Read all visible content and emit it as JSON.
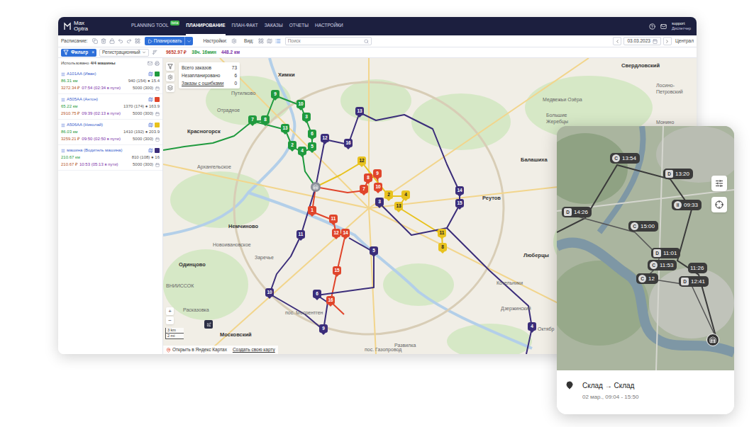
{
  "header": {
    "logo_top": "Max",
    "logo_bottom": "Optra",
    "nav": [
      {
        "label": "PLANNING TOOL",
        "badge": "beta",
        "selected": false
      },
      {
        "label": "ПЛАНИРОВАНИЕ",
        "badge": "",
        "selected": true
      },
      {
        "label": "ПЛАН-ФАКТ",
        "badge": "",
        "selected": false
      },
      {
        "label": "ЗАКАЗЫ",
        "badge": "",
        "selected": false
      },
      {
        "label": "ОТЧЕТЫ",
        "badge": "",
        "selected": false
      },
      {
        "label": "НАСТРОЙКИ",
        "badge": "",
        "selected": false
      }
    ],
    "user": "support",
    "role": "Диспетчер"
  },
  "toolbar": {
    "schedule_label": "Расписание:",
    "plan_button": "Планировать",
    "settings_label": "Настройки:",
    "view_label": "Вид:",
    "search_placeholder": "Поиск",
    "date": "03.03.2023",
    "region": "Централ"
  },
  "filter_bar": {
    "filter": "Фильтр",
    "clear": "×",
    "sort": "Регистрационный",
    "cost": "9652.97 ₽",
    "time": "38ч. 16мин",
    "distance": "448.2 км"
  },
  "vehicles_panel": {
    "used_label": "Использовано",
    "used_value": "4/4 машины",
    "vehicles": [
      {
        "name": "A101AA (Иван)",
        "color": "#1f9a3e",
        "distance": "86.31 км",
        "load": "940 (154) ● 15.4",
        "cost": "3272.34 ₽",
        "time": "07:54 (02:34 в пути)",
        "capacity": "5000 (300)"
      },
      {
        "name": "A505AA (Антон)",
        "color": "#e0452b",
        "distance": "65.22 км",
        "load": "1370 (174) ● 163.9",
        "cost": "2910.75 ₽",
        "time": "09:39 (02:13 в пути)",
        "capacity": "5000 (300)"
      },
      {
        "name": "A506AA (Николай)",
        "color": "#e8c21e",
        "distance": "86.03 км",
        "load": "1410 (192) ● 203.9",
        "cost": "3259.21 ₽",
        "time": "09:50 (02:50 в пути)",
        "capacity": "5000 (300)"
      },
      {
        "name": "машина (Водитель машина)",
        "color": "#3b2d7a",
        "distance": "210.67 км",
        "load": "810 (108) ● 16",
        "cost": "210.67 ₽",
        "time": "10:53 (05:13 в пути)",
        "capacity": "5000 (300)"
      }
    ]
  },
  "map": {
    "summary": [
      {
        "label": "Всего заказов",
        "value": "73",
        "underlined": false
      },
      {
        "label": "Незапланировано",
        "value": "6",
        "underlined": false
      },
      {
        "label": "Заказы с ошибками",
        "value": "0",
        "underlined": true
      }
    ],
    "labels": [
      {
        "text": "Химки",
        "bold": true
      },
      {
        "text": "Свердловский",
        "bold": true
      },
      {
        "text": "Лосино-Петровский",
        "bold": false
      },
      {
        "text": "Путилково",
        "bold": false
      },
      {
        "text": "Отрадное",
        "bold": false
      },
      {
        "text": "Красногорск",
        "bold": true
      },
      {
        "text": "Медвежьи Озёра",
        "bold": false
      },
      {
        "text": "Большие Жеребцы",
        "bold": false
      },
      {
        "text": "Монино",
        "bold": false
      },
      {
        "text": "Балашиха",
        "bold": true
      },
      {
        "text": "Реутов",
        "bold": true
      },
      {
        "text": "Архангельское",
        "bold": false
      },
      {
        "text": "Немчиново",
        "bold": true
      },
      {
        "text": "Новоивановское",
        "bold": false
      },
      {
        "text": "Заречье",
        "bold": false
      },
      {
        "text": "Одинцово",
        "bold": true
      },
      {
        "text": "Люберцы",
        "bold": true
      },
      {
        "text": "Котельники",
        "bold": false
      },
      {
        "text": "Дзержинский",
        "bold": false
      },
      {
        "text": "пос. Мосрентген",
        "bold": false
      },
      {
        "text": "Московский",
        "bold": true
      },
      {
        "text": "Развилка",
        "bold": false
      },
      {
        "text": "Расказовка",
        "bold": false
      },
      {
        "text": "ВНИИССОК",
        "bold": false
      },
      {
        "text": "пос. Газопровод",
        "bold": false
      },
      {
        "text": "Октябр",
        "bold": false
      }
    ],
    "pins": [
      {
        "label": "9",
        "color": "#1f9a3e"
      },
      {
        "label": "10",
        "color": "#1f9a3e"
      },
      {
        "label": "3",
        "color": "#1f9a3e"
      },
      {
        "label": "7",
        "color": "#1f9a3e"
      },
      {
        "label": "8",
        "color": "#1f9a3e"
      },
      {
        "label": "13",
        "color": "#1f9a3e"
      },
      {
        "label": "6",
        "color": "#1f9a3e"
      },
      {
        "label": "2",
        "color": "#1f9a3e"
      },
      {
        "label": "4",
        "color": "#1f9a3e"
      },
      {
        "label": "5",
        "color": "#1f9a3e"
      },
      {
        "label": "13",
        "color": "#3b2d7a"
      },
      {
        "label": "16",
        "color": "#3b2d7a"
      },
      {
        "label": "12",
        "color": "#3b2d7a"
      },
      {
        "label": "14",
        "color": "#3b2d7a"
      },
      {
        "label": "15",
        "color": "#3b2d7a"
      },
      {
        "label": "11",
        "color": "#3b2d7a"
      },
      {
        "label": "3",
        "color": "#3b2d7a"
      },
      {
        "label": "5",
        "color": "#3b2d7a"
      },
      {
        "label": "6",
        "color": "#3b2d7a"
      },
      {
        "label": "10",
        "color": "#3b2d7a"
      },
      {
        "label": "9",
        "color": "#3b2d7a"
      },
      {
        "label": "4",
        "color": "#3b2d7a"
      },
      {
        "label": "1",
        "color": "#e0452b"
      },
      {
        "label": "11",
        "color": "#e0452b"
      },
      {
        "label": "12",
        "color": "#e0452b"
      },
      {
        "label": "14",
        "color": "#e0452b"
      },
      {
        "label": "15",
        "color": "#e0452b"
      },
      {
        "label": "16",
        "color": "#e0452b"
      },
      {
        "label": "9",
        "color": "#e0452b"
      },
      {
        "label": "8",
        "color": "#e0452b"
      },
      {
        "label": "7",
        "color": "#e0452b"
      },
      {
        "label": "10",
        "color": "#e0452b"
      },
      {
        "label": "12",
        "color": "#e8c21e"
      },
      {
        "label": "2",
        "color": "#e8c21e"
      },
      {
        "label": "4",
        "color": "#e8c21e"
      },
      {
        "label": "13",
        "color": "#e8c21e"
      },
      {
        "label": "11",
        "color": "#e8c21e"
      },
      {
        "label": "8",
        "color": "#e8c21e"
      }
    ],
    "scale": [
      "3 km",
      "2 mi"
    ],
    "zoom": [
      "+",
      "−"
    ],
    "links": [
      "Открыть в Яндекс Картах",
      "Создать свою карту"
    ]
  },
  "mobile": {
    "markers": [
      {
        "letter": "C",
        "time": "13:54",
        "kind": "collection"
      },
      {
        "letter": "D",
        "time": "13:20",
        "kind": "delivery"
      },
      {
        "letter": "D",
        "time": "14:26",
        "kind": "delivery"
      },
      {
        "letter": "II",
        "time": "09:33",
        "kind": "break"
      },
      {
        "letter": "C",
        "time": "15:00",
        "kind": "collection"
      },
      {
        "letter": "D",
        "time": "11:01",
        "kind": "delivery"
      },
      {
        "letter": "C",
        "time": "11:53",
        "kind": "collection"
      },
      {
        "letter": "C",
        "time": "12",
        "kind": "collection"
      },
      {
        "letter": "",
        "time": "11:26",
        "kind": "none"
      },
      {
        "letter": "D",
        "time": "12:41",
        "kind": "delivery"
      }
    ],
    "card": {
      "title": "Склад → Склад",
      "subtitle": "02 мар., 09:04 - 15:50"
    }
  }
}
